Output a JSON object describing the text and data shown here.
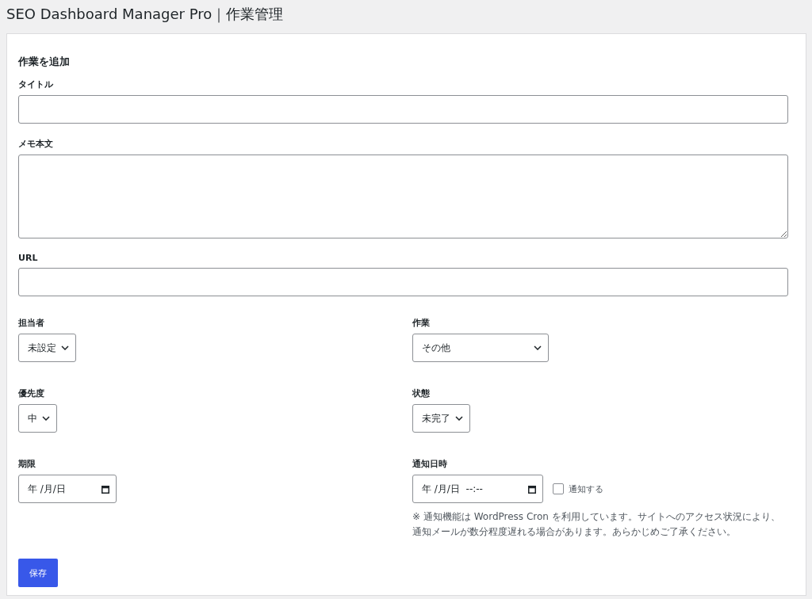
{
  "page_title": "SEO Dashboard Manager Pro｜作業管理",
  "form": {
    "heading": "作業を追加",
    "fields": [
      {
        "kind": "text",
        "label": "タイトル"
      },
      {
        "kind": "textarea",
        "label": "メモ本文"
      },
      {
        "kind": "text",
        "label": "URL"
      }
    ],
    "grid": [
      {
        "kind": "select",
        "label": "担当者",
        "value": "未設定"
      },
      {
        "kind": "select",
        "label": "作業",
        "value": "その他"
      },
      {
        "kind": "select",
        "label": "優先度",
        "value": "中"
      },
      {
        "kind": "select",
        "label": "状態",
        "value": "未完了"
      },
      {
        "kind": "date",
        "label": "期限",
        "date": "年 /月/日"
      },
      {
        "kind": "datetime",
        "label": "通知日時",
        "date": "年 /月/日",
        "time": "--:--",
        "checkbox": {
          "label": "通知する",
          "checked": false
        },
        "note": "※ 通知機能は WordPress Cron を利用しています。サイトへのアクセス状況により、通知メールが数分程度遅れる場合があります。あらかじめご了承ください。"
      }
    ],
    "submit": "保存"
  }
}
